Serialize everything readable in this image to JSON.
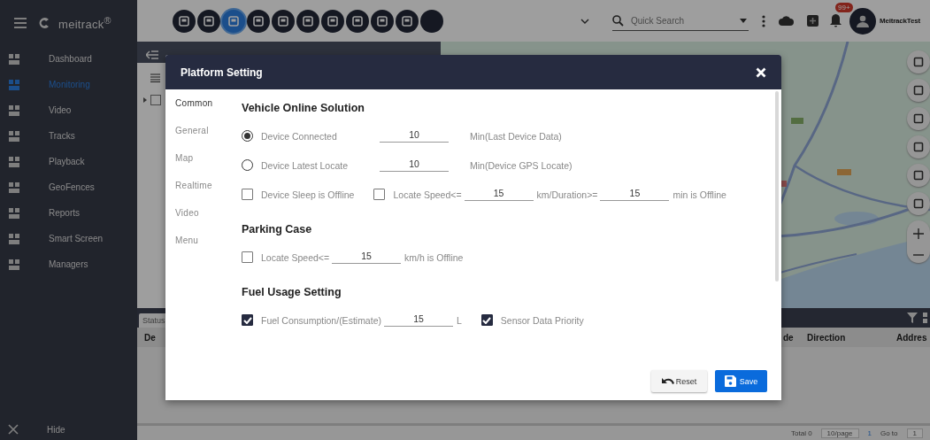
{
  "sidebar": {
    "logo": "meitrack$^{®}$",
    "items": [
      {
        "label": "Dashboard",
        "selected": false
      },
      {
        "label": "Monitoring",
        "selected": true
      },
      {
        "label": "Video",
        "selected": false
      },
      {
        "label": "Tracks",
        "selected": false
      },
      {
        "label": "Playback",
        "selected": false
      },
      {
        "label": "GeoFences",
        "selected": false
      },
      {
        "label": "Reports",
        "selected": false
      },
      {
        "label": "Smart Screen",
        "selected": false
      },
      {
        "label": "Managers",
        "selected": false
      }
    ],
    "hide": "Hide"
  },
  "topbar": {
    "modules": [
      {
        "selected": false
      },
      {
        "selected": false
      },
      {
        "selected": true
      },
      {
        "selected": false
      },
      {
        "selected": false
      },
      {
        "selected": false
      },
      {
        "selected": false
      },
      {
        "selected": false
      },
      {
        "selected": false
      },
      {
        "selected": false
      },
      {
        "selected": false
      }
    ],
    "search": {
      "placeholder": "Quick Search"
    },
    "notifications": "99+",
    "user": "MeitrackTest"
  },
  "behind": {
    "tree_checked": false,
    "status_tab": "Status",
    "columns": [
      "De",
      "de",
      "Direction",
      "Addres"
    ],
    "pager": {
      "total": "Total 0",
      "page_size": "10/page",
      "page": "1",
      "goto": "Go to",
      "goto_value": "1"
    }
  },
  "dialog": {
    "title": "Platform Setting",
    "nav": [
      {
        "label": "Common",
        "selected": true
      },
      {
        "label": "General",
        "selected": false
      },
      {
        "label": "Map",
        "selected": false
      },
      {
        "label": "Realtime",
        "selected": false
      },
      {
        "label": "Video",
        "selected": false
      },
      {
        "label": "Menu",
        "selected": false
      }
    ],
    "sections": [
      {
        "title": "Vehicle Online Solution",
        "rows": [
          [
            {
              "kind": "radio",
              "label": "Device Connected",
              "checked": true
            },
            {
              "kind": "field",
              "value": "10"
            },
            {
              "kind": "text",
              "text": "Min(Last Device Data)"
            }
          ],
          [
            {
              "kind": "radio",
              "label": "Device Latest Locate",
              "checked": false
            },
            {
              "kind": "field",
              "value": "10"
            },
            {
              "kind": "text",
              "text": "Min(Device GPS Locate)"
            }
          ],
          [
            {
              "kind": "checkbox",
              "label": "Device Sleep is Offline",
              "checked": false
            },
            {
              "kind": "checkbox",
              "label": "Locate Speed<=",
              "checked": false
            },
            {
              "kind": "field",
              "value": "15"
            },
            {
              "kind": "text",
              "text": "km/Duration>="
            },
            {
              "kind": "field",
              "value": "15"
            },
            {
              "kind": "text",
              "text": "min is Offline"
            }
          ]
        ]
      },
      {
        "title": "Parking Case",
        "rows": [
          [
            {
              "kind": "checkbox",
              "label": "Locate Speed<=",
              "checked": false
            },
            {
              "kind": "field",
              "value": "15"
            },
            {
              "kind": "text",
              "text": "km/h is Offline"
            }
          ]
        ]
      },
      {
        "title": "Fuel Usage Setting",
        "rows": [
          [
            {
              "kind": "checkbox",
              "label": "Fuel Consumption/(Estimate)",
              "checked": true
            },
            {
              "kind": "field",
              "value": "15"
            },
            {
              "kind": "text",
              "text": "L"
            },
            {
              "kind": "checkbox",
              "label": "Sensor Data Priority",
              "checked": true
            }
          ]
        ]
      }
    ],
    "buttons": {
      "reset": "Reset",
      "save": "Save"
    }
  }
}
